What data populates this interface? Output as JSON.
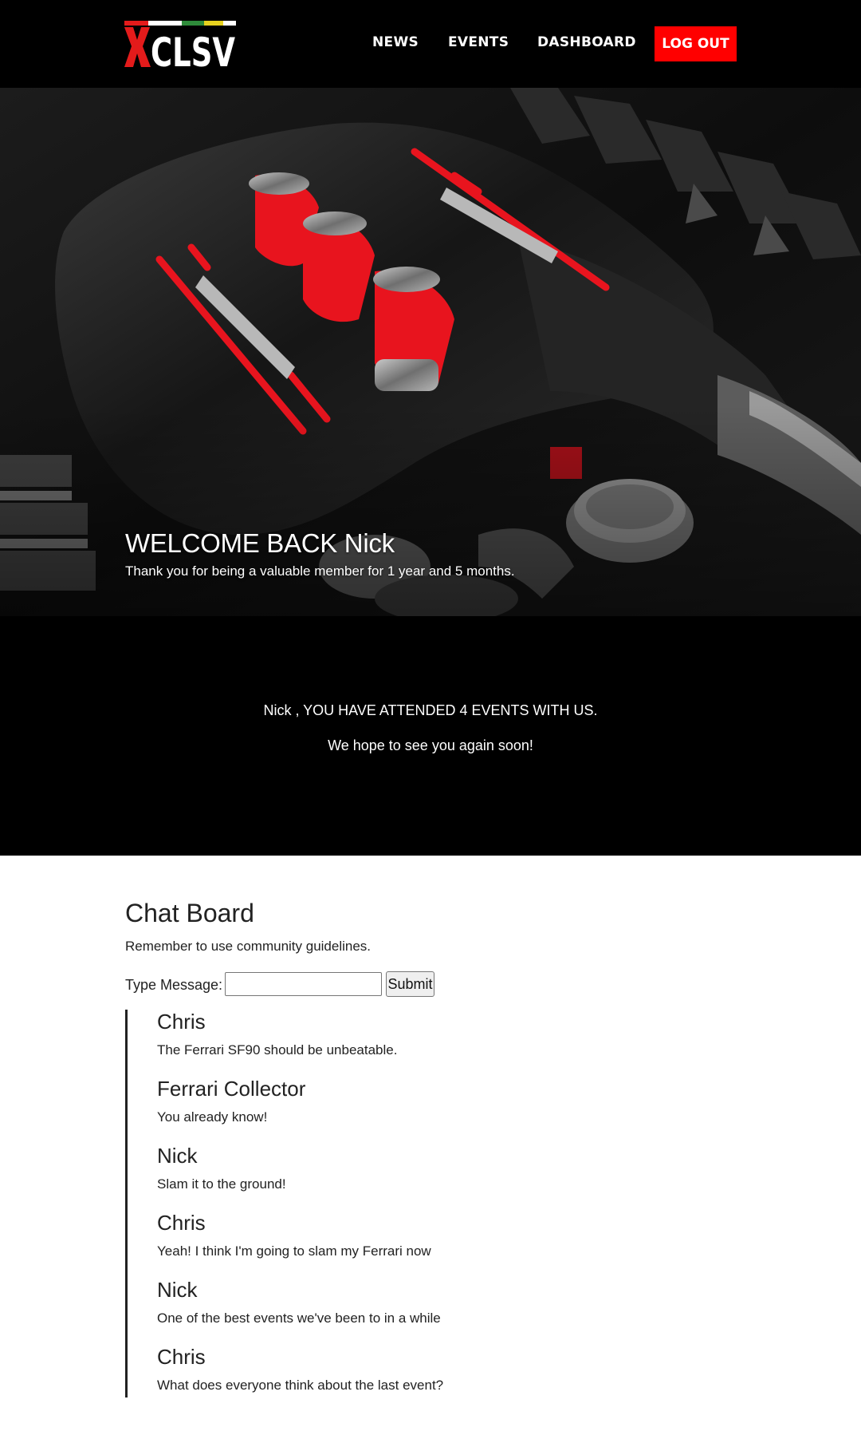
{
  "header": {
    "logo_text": "XCLSV",
    "nav": [
      {
        "label": "NEWS"
      },
      {
        "label": "EVENTS"
      },
      {
        "label": "DASHBOARD"
      }
    ],
    "logout_label": "LOG OUT",
    "colors": {
      "background": "#000000",
      "accent": "#ff0000",
      "logo_bar": [
        "#e41b1b",
        "#ffffff",
        "#2e8b3a",
        "#e7d21f",
        "#ffffff"
      ]
    }
  },
  "hero": {
    "title": "WELCOME BACK Nick",
    "subtitle": "Thank you for being a valuable member for 1 year and 5 months."
  },
  "stats": {
    "line1": "Nick , YOU HAVE ATTENDED 4 EVENTS WITH US.",
    "line2": "We hope to see you again soon!"
  },
  "chat": {
    "title": "Chat Board",
    "guidelines": "Remember to use community guidelines.",
    "form": {
      "label": "Type Message:",
      "input_value": "",
      "input_placeholder": "",
      "submit_label": "Submit"
    },
    "messages": [
      {
        "author": "Chris",
        "text": "The Ferrari SF90 should be unbeatable."
      },
      {
        "author": "Ferrari Collector",
        "text": "You already know!"
      },
      {
        "author": "Nick",
        "text": "Slam it to the ground!"
      },
      {
        "author": "Chris",
        "text": "Yeah! I think I'm going to slam my Ferrari now"
      },
      {
        "author": "Nick",
        "text": "One of the best events we've been to in a while"
      },
      {
        "author": "Chris",
        "text": "What does everyone think about the last event?"
      }
    ]
  }
}
